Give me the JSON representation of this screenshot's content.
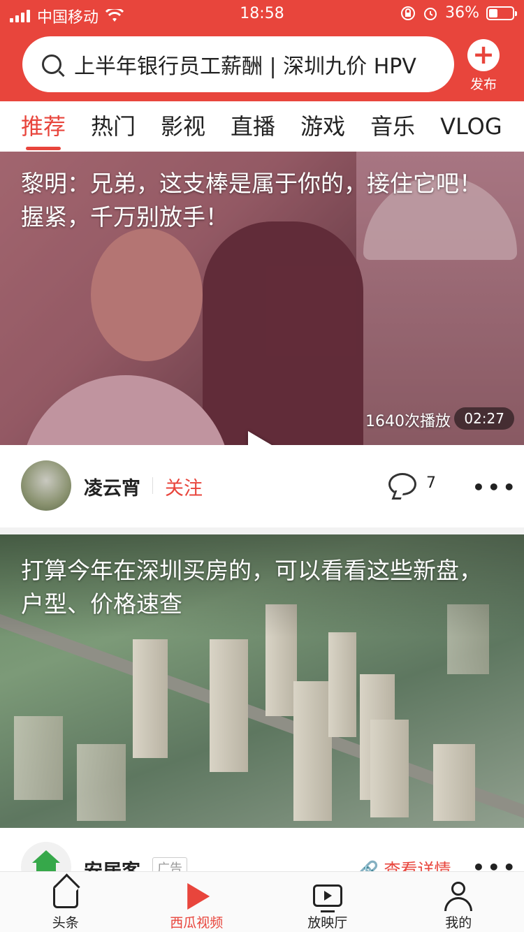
{
  "status_bar": {
    "carrier": "中国移动",
    "time": "18:58",
    "battery": "36%",
    "battery_level": 0.36
  },
  "search": {
    "placeholder": "上半年银行员工薪酬 | 深圳九价 HPV"
  },
  "publish_button": {
    "label": "发布"
  },
  "tabs": [
    {
      "label": "推荐",
      "active": true
    },
    {
      "label": "热门",
      "active": false
    },
    {
      "label": "影视",
      "active": false
    },
    {
      "label": "直播",
      "active": false
    },
    {
      "label": "游戏",
      "active": false
    },
    {
      "label": "音乐",
      "active": false
    },
    {
      "label": "VLOG",
      "active": false
    }
  ],
  "feed": [
    {
      "title": "黎明：兄弟，这支棒是属于你的，接住它吧！握紧，千万别放手！",
      "play_count": "1640次播放",
      "duration": "02:27",
      "author": "凌云宵",
      "follow_label": "关注",
      "comment_count": "7",
      "more_label": "•••"
    },
    {
      "title": "打算今年在深圳买房的，可以看看这些新盘，户型、价格速查",
      "author": "安居客",
      "ad_label": "广告",
      "detail_label": "查看详情",
      "more_label": "•••"
    }
  ],
  "bottom_nav": [
    {
      "label": "头条",
      "icon": "home-icon",
      "active": false
    },
    {
      "label": "西瓜视频",
      "icon": "play-icon",
      "active": true
    },
    {
      "label": "放映厅",
      "icon": "tv-icon",
      "active": false
    },
    {
      "label": "我的",
      "icon": "user-icon",
      "active": false
    }
  ],
  "colors": {
    "accent": "#e8453c",
    "text": "#222222"
  }
}
